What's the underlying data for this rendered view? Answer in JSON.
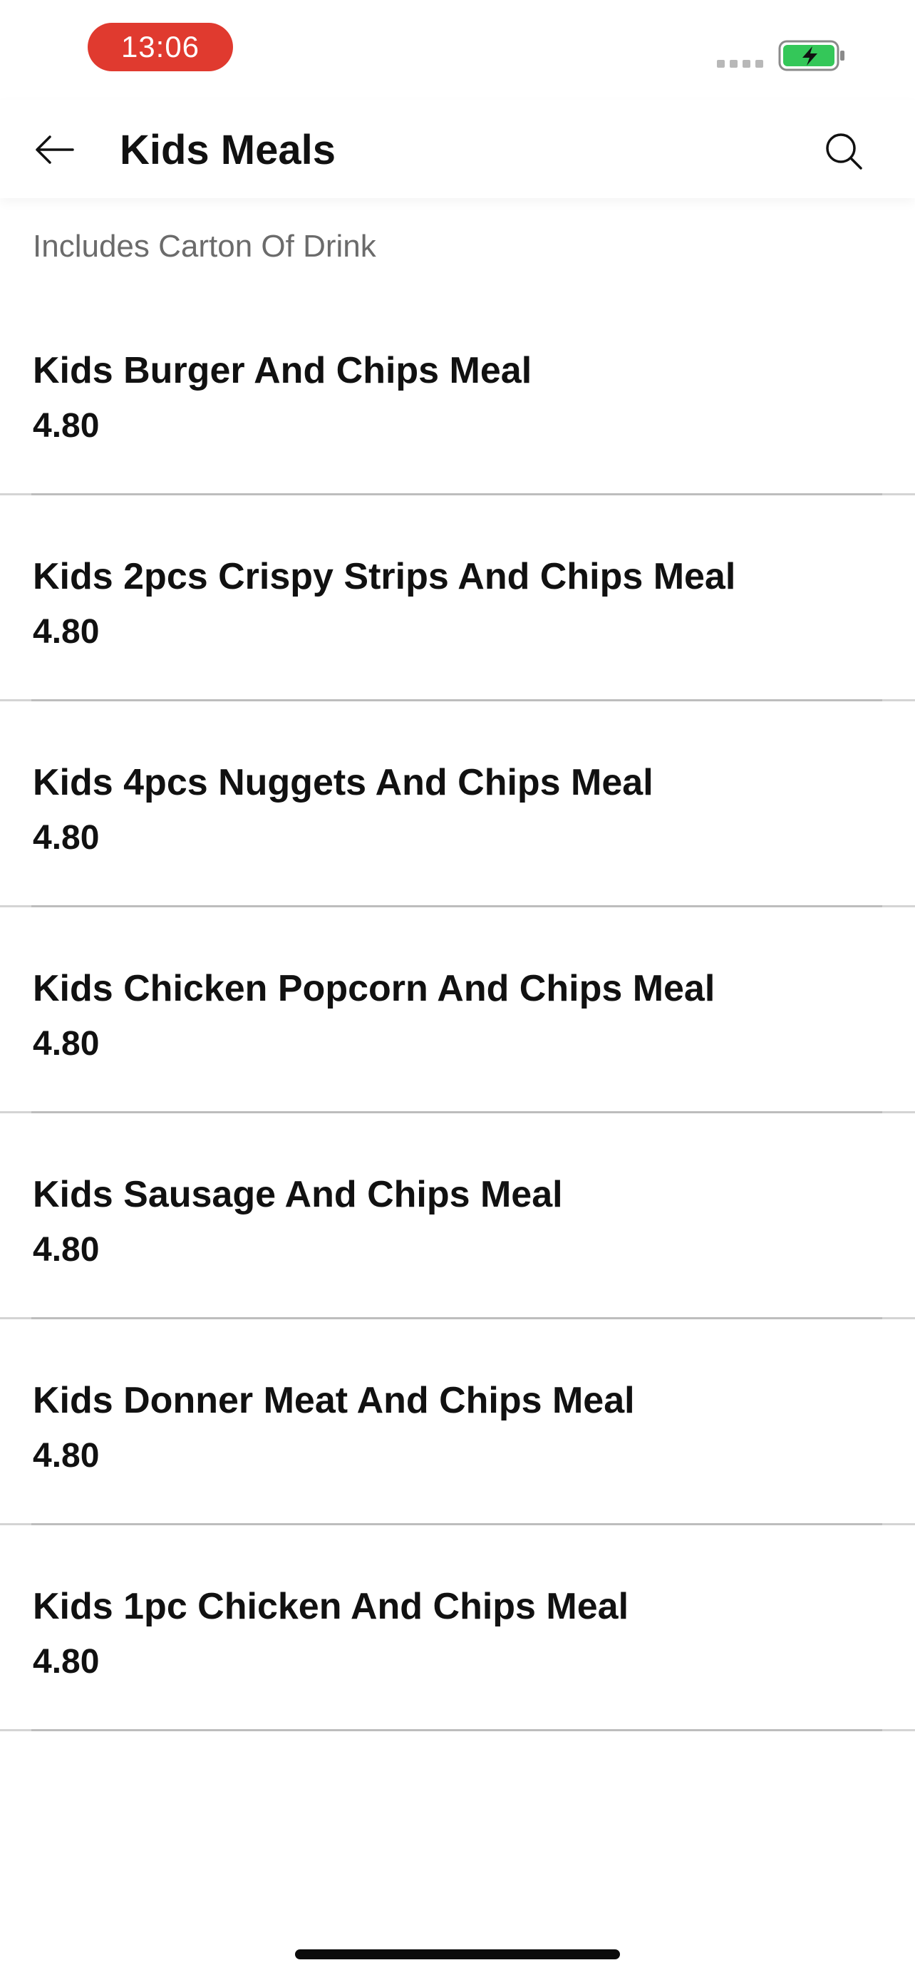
{
  "status_bar": {
    "time": "13:06",
    "time_pill_color": "#e03a2f",
    "battery_color": "#34c759",
    "icons": [
      "signal-icon",
      "battery-charging-icon"
    ]
  },
  "nav": {
    "title": "Kids Meals",
    "back_icon": "arrow-left-icon",
    "search_icon": "search-icon"
  },
  "category_description": "Includes Carton Of Drink",
  "items": [
    {
      "name": "Kids Burger And Chips Meal",
      "price": "4.80"
    },
    {
      "name": "Kids 2pcs Crispy Strips And Chips Meal",
      "price": "4.80"
    },
    {
      "name": "Kids 4pcs Nuggets And Chips Meal",
      "price": "4.80"
    },
    {
      "name": "Kids Chicken Popcorn And Chips Meal",
      "price": "4.80"
    },
    {
      "name": "Kids Sausage And Chips Meal",
      "price": "4.80"
    },
    {
      "name": "Kids Donner Meat And Chips Meal",
      "price": "4.80"
    },
    {
      "name": "Kids 1pc Chicken And Chips Meal",
      "price": "4.80"
    }
  ]
}
